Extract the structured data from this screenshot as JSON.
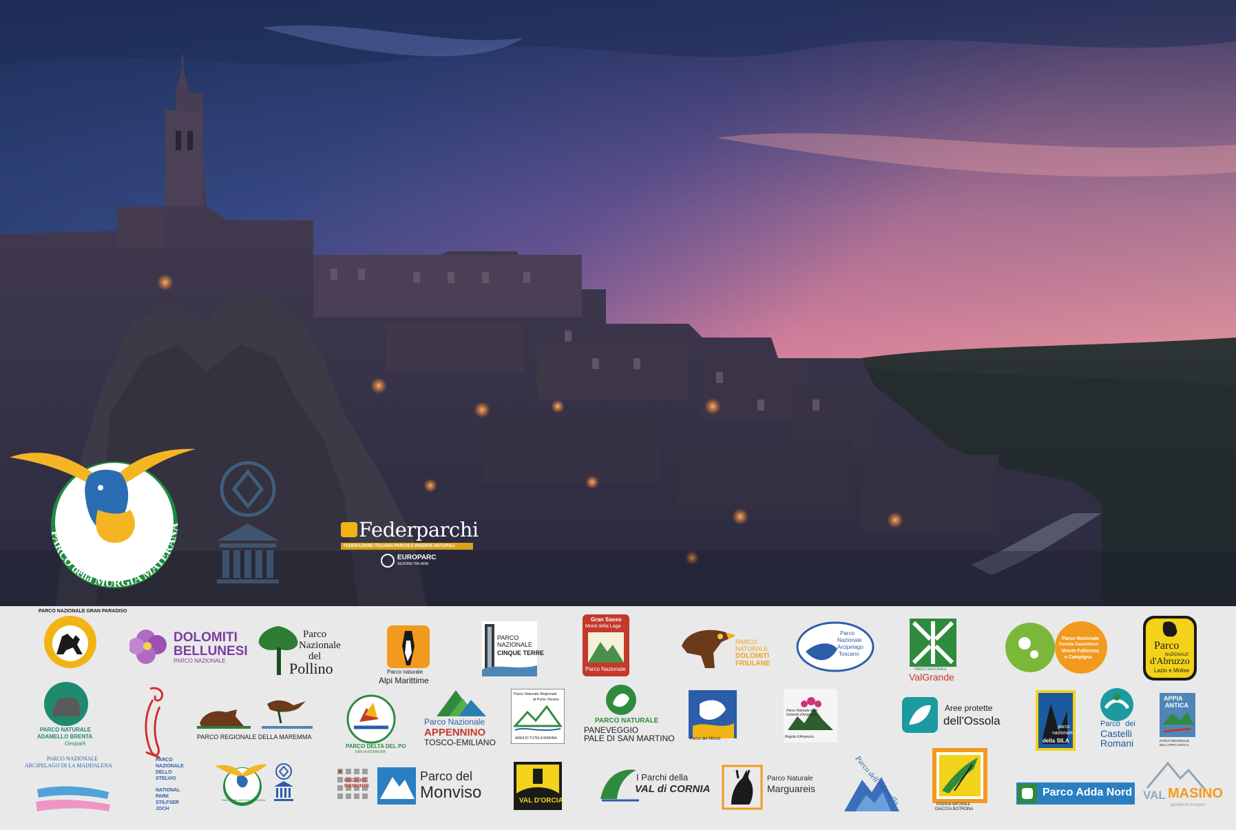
{
  "header_logos": {
    "murgia_text": "PARCO della MURGIA MATERANA",
    "federparchi_title": "Federparchi",
    "federparchi_sub": "FEDERAZIONE ITALIANA PARCHI E RISERVE NATURALI",
    "europarc": "EUROPARC",
    "europarc_sub": "SEZIONE ITALIANA"
  },
  "park_logos": {
    "gran_paradiso": "PARCO NAZIONALE GRAN PARADISO",
    "dolomiti_bellunesi_1": "DOLOMITI",
    "dolomiti_bellunesi_2": "BELLUNESI",
    "dolomiti_bellunesi_3": "PARCO NAZIONALE",
    "pollino_1": "Parco",
    "pollino_2": "Nazionale",
    "pollino_3": "del",
    "pollino_4": "Pollino",
    "alpi_marittime_1": "Parco naturale",
    "alpi_marittime_2": "Alpi Marittime",
    "cinque_terre_1": "PARCO",
    "cinque_terre_2": "NAZIONALE",
    "cinque_terre_3": "CINQUE TERRE",
    "gran_sasso_1": "Gran Sasso",
    "gran_sasso_2": "Monti della Laga",
    "gran_sasso_3": "Parco Nazionale",
    "dolomiti_friulane_1": "PARCO",
    "dolomiti_friulane_2": "NATURALE",
    "dolomiti_friulane_3": "DOLOMITI",
    "dolomiti_friulane_4": "FRIULANE",
    "arcipelago_toscano_1": "Parco",
    "arcipelago_toscano_2": "Nazionale",
    "arcipelago_toscano_3": "Arcipelago",
    "arcipelago_toscano_4": "Toscano",
    "valgrande_1": "PARCO NAZIONALE",
    "valgrande_2": "ValGrande",
    "foreste_casentinesi_1": "Parco Nazionale",
    "foreste_casentinesi_2": "Foreste Casentinesi",
    "foreste_casentinesi_3": "Monte Falterona",
    "foreste_casentinesi_4": "e Campigna",
    "abruzzo_1": "Parco",
    "abruzzo_2": "NAZIONALE",
    "abruzzo_3": "d'Abruzzo",
    "abruzzo_4": "Lazio e Molise",
    "adamello_brenta_1": "PARCO NATURALE",
    "adamello_brenta_2": "ADAMELLO BRENTA",
    "adamello_brenta_3": "Geopark",
    "maremma": "PARCO REGIONALE DELLA MAREMMA",
    "delta_po_1": "PARCO DELTA DEL PO",
    "delta_po_2": "EMILIA-ROMAGNA",
    "appennino_1": "Parco Nazionale",
    "appennino_2": "APPENNINO",
    "appennino_3": "TOSCO-EMILIANO",
    "porto_venere_1": "Parco Naturale Regionale",
    "porto_venere_2": "di Porto Venere",
    "porto_venere_3": "AREA DI TUTELA MARINA",
    "paneveggio_1": "PARCO NATURALE",
    "paneveggio_2": "PANEVEGGIO",
    "paneveggio_3": "PALE DI SAN MARTINO",
    "mincio": "Parco del Mincio",
    "ampezzo_1": "Parco Naturale delle",
    "ampezzo_2": "Dolomiti d'Ampezzo",
    "ampezzo_3": "Regole d'Ampezzo",
    "ossola_1": "Aree protette",
    "ossola_2": "dell'Ossola",
    "sila_1": "parco",
    "sila_2": "nazionale",
    "sila_3": "della SILA",
    "castelli_romani_1": "Parco",
    "castelli_romani_2": "dei",
    "castelli_romani_3": "Castelli",
    "castelli_romani_4": "Romani",
    "appia_antica_1": "APPIA",
    "appia_antica_2": "ANTICA",
    "appia_antica_3": "PARCO REGIONALE",
    "appia_antica_4": "DELL'APPIA ANTICA",
    "maddalena_1": "PARCO NAZIONALE",
    "maddalena_2": "ARCIPELAGO DI LA MADDALENA",
    "stelvio_1": "PARCO",
    "stelvio_2": "NAZIONALE",
    "stelvio_3": "DELLO",
    "stelvio_4": "STELVIO",
    "stelvio_5": "NATIONAL",
    "stelvio_6": "PARK",
    "stelvio_7": "STILFSER",
    "stelvio_8": "JOCH",
    "murgia_small": "PARCO della MURGIA MATERANA",
    "piemonte_1": "REGIONE",
    "piemonte_2": "PIEMONTE",
    "monviso_1": "Parco del",
    "monviso_2": "Monviso",
    "val_orcia": "VAL D'ORCIA",
    "val_cornia_1": "I Parchi della",
    "val_cornia_2": "VAL di CORNIA",
    "marguareis_1": "Parco Naturale",
    "marguareis_2": "Marguareis",
    "adamello_1": "Parco dell'",
    "adamello_2": "Adamello",
    "diaccia_1": "RISERVA NATURALE",
    "diaccia_2": "DIACCIA BOTRONA",
    "adda_nord": "Parco Adda Nord",
    "valmasino_1": "VAL",
    "valmasino_2": "MASINO",
    "valmasino_3": "gentilezze insegne"
  }
}
